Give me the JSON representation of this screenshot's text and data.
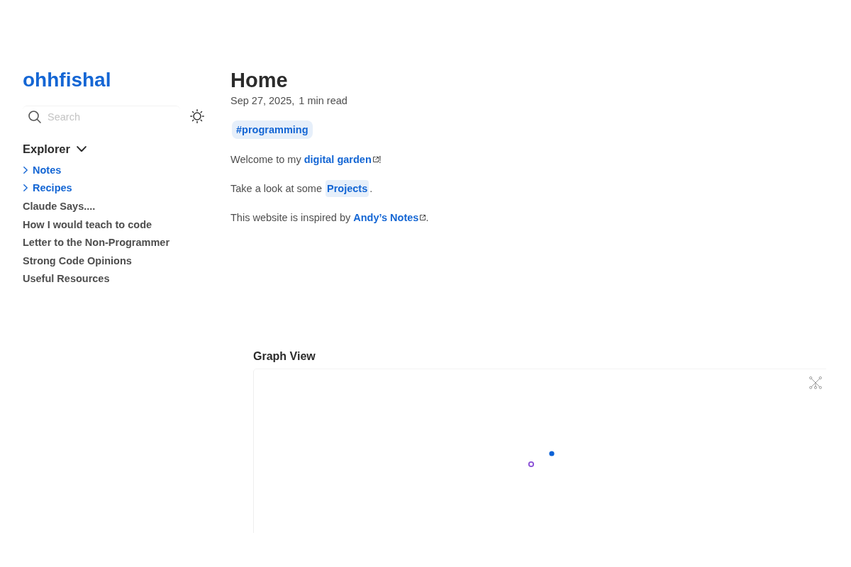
{
  "sidebar": {
    "site_title": "ohhfishal",
    "search": {
      "placeholder": "Search"
    },
    "explorer": {
      "title": "Explorer",
      "expanded": true,
      "items": [
        {
          "kind": "folder",
          "label": "Notes",
          "expanded": false
        },
        {
          "kind": "folder",
          "label": "Recipes",
          "expanded": false
        },
        {
          "kind": "file",
          "label": "Claude Says...."
        },
        {
          "kind": "file",
          "label": "How I would teach to code"
        },
        {
          "kind": "file",
          "label": "Letter to the Non-Programmer"
        },
        {
          "kind": "file",
          "label": "Strong Code Opinions"
        },
        {
          "kind": "file",
          "label": "Useful Resources"
        }
      ]
    }
  },
  "page": {
    "title": "Home",
    "date": "Sep 27, 2025,",
    "reading_time": "1 min read",
    "tags": [
      "#programming"
    ],
    "paragraphs": [
      [
        {
          "kind": "text",
          "text": "Welcome to my "
        },
        {
          "kind": "external_link",
          "text": "digital garden"
        },
        {
          "kind": "text",
          "text": "!"
        }
      ],
      [
        {
          "kind": "text",
          "text": "Take a look at some "
        },
        {
          "kind": "internal_link",
          "text": "Projects"
        },
        {
          "kind": "text",
          "text": "."
        }
      ],
      [
        {
          "kind": "text",
          "text": "This website is inspired by "
        },
        {
          "kind": "external_link",
          "text": "Andy’s Notes"
        },
        {
          "kind": "text",
          "text": "."
        }
      ]
    ]
  },
  "graph": {
    "title": "Graph View",
    "nodes": [
      {
        "kind": "current"
      },
      {
        "kind": "linked"
      }
    ]
  }
}
